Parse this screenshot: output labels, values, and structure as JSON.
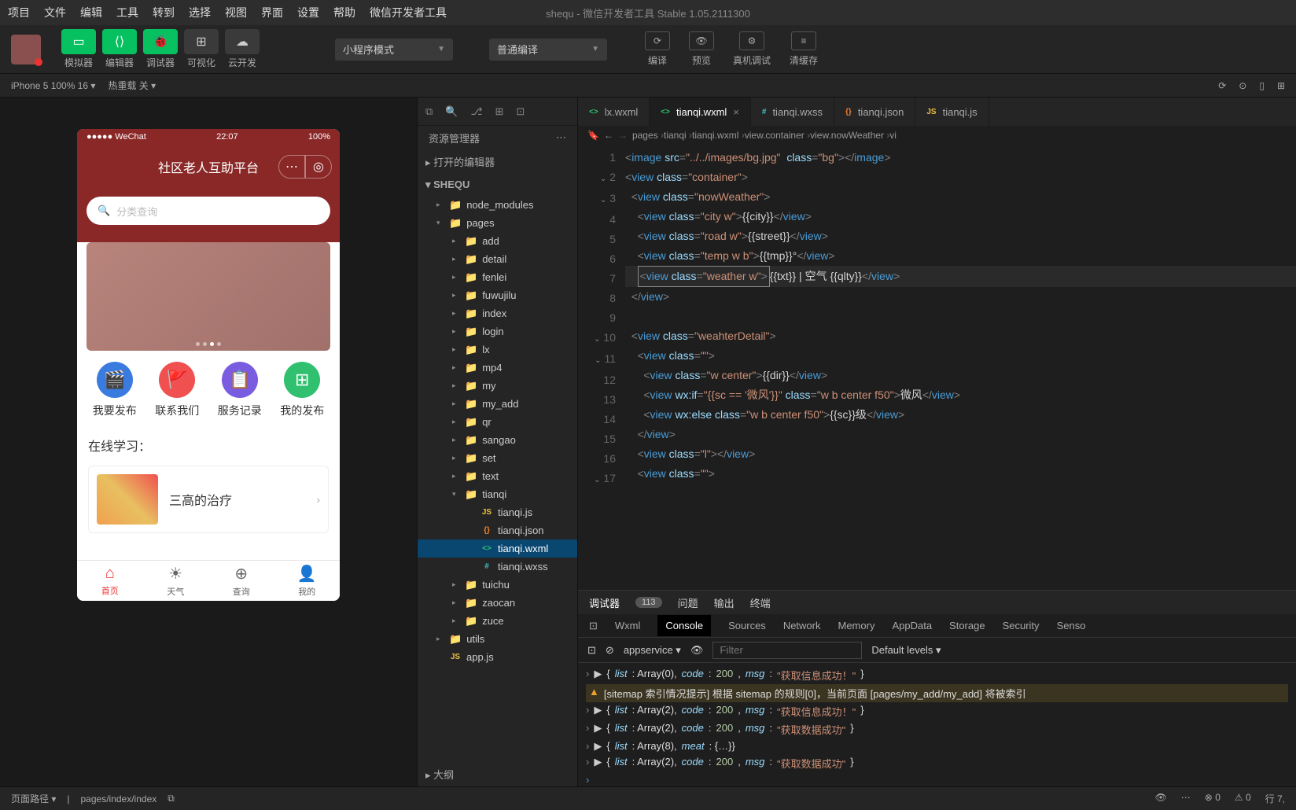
{
  "menubar": [
    "项目",
    "文件",
    "编辑",
    "工具",
    "转到",
    "选择",
    "视图",
    "界面",
    "设置",
    "帮助",
    "微信开发者工具"
  ],
  "window_title": "shequ - 微信开发者工具 Stable 1.05.2111300",
  "toolbar": {
    "items": [
      {
        "label": "模拟器"
      },
      {
        "label": "编辑器"
      },
      {
        "label": "调试器"
      },
      {
        "label": "可视化"
      },
      {
        "label": "云开发"
      }
    ],
    "mode_dropdown": "小程序模式",
    "compile_dropdown": "普通编译",
    "actions": [
      {
        "label": "编译"
      },
      {
        "label": "预览"
      },
      {
        "label": "真机调试"
      },
      {
        "label": "清缓存"
      }
    ]
  },
  "secondbar": {
    "device": "iPhone 5 100% 16",
    "reload": "热重载 关"
  },
  "phone": {
    "carrier": "●●●●● WeChat",
    "time": "22:07",
    "battery": "100%",
    "title": "社区老人互助平台",
    "search_placeholder": "分类查询",
    "icons": [
      {
        "label": "我要发布",
        "color": "#3a7be0"
      },
      {
        "label": "联系我们",
        "color": "#f05050"
      },
      {
        "label": "服务记录",
        "color": "#7a5ce0"
      },
      {
        "label": "我的发布",
        "color": "#30c070"
      }
    ],
    "section": "在线学习：",
    "card_title": "三高的治疗",
    "tabs": [
      {
        "label": "首页",
        "active": true
      },
      {
        "label": "天气",
        "active": false
      },
      {
        "label": "查询",
        "active": false
      },
      {
        "label": "我的",
        "active": false
      }
    ]
  },
  "explorer": {
    "title": "资源管理器",
    "open_editors": "打开的编辑器",
    "root": "SHEQU",
    "outline": "大纲",
    "tree": [
      {
        "name": "node_modules",
        "type": "folder",
        "indent": 1,
        "expanded": false,
        "color": "#30c070"
      },
      {
        "name": "pages",
        "type": "folder",
        "indent": 1,
        "expanded": true,
        "color": "#c09050"
      },
      {
        "name": "add",
        "type": "folder",
        "indent": 2
      },
      {
        "name": "detail",
        "type": "folder",
        "indent": 2
      },
      {
        "name": "fenlei",
        "type": "folder",
        "indent": 2
      },
      {
        "name": "fuwujilu",
        "type": "folder",
        "indent": 2
      },
      {
        "name": "index",
        "type": "folder",
        "indent": 2
      },
      {
        "name": "login",
        "type": "folder",
        "indent": 2
      },
      {
        "name": "lx",
        "type": "folder",
        "indent": 2
      },
      {
        "name": "mp4",
        "type": "folder",
        "indent": 2
      },
      {
        "name": "my",
        "type": "folder",
        "indent": 2
      },
      {
        "name": "my_add",
        "type": "folder",
        "indent": 2
      },
      {
        "name": "qr",
        "type": "folder",
        "indent": 2
      },
      {
        "name": "sangao",
        "type": "folder",
        "indent": 2
      },
      {
        "name": "set",
        "type": "folder",
        "indent": 2
      },
      {
        "name": "text",
        "type": "folder",
        "indent": 2
      },
      {
        "name": "tianqi",
        "type": "folder",
        "indent": 2,
        "expanded": true
      },
      {
        "name": "tianqi.js",
        "type": "file",
        "indent": 3,
        "ficon": "JS",
        "fcolor": "#f0c040"
      },
      {
        "name": "tianqi.json",
        "type": "file",
        "indent": 3,
        "ficon": "{}",
        "fcolor": "#f08030"
      },
      {
        "name": "tianqi.wxml",
        "type": "file",
        "indent": 3,
        "ficon": "<>",
        "fcolor": "#30c070",
        "selected": true
      },
      {
        "name": "tianqi.wxss",
        "type": "file",
        "indent": 3,
        "ficon": "#",
        "fcolor": "#40c0d0"
      },
      {
        "name": "tuichu",
        "type": "folder",
        "indent": 2
      },
      {
        "name": "zaocan",
        "type": "folder",
        "indent": 2
      },
      {
        "name": "zuce",
        "type": "folder",
        "indent": 2
      },
      {
        "name": "utils",
        "type": "folder",
        "indent": 1,
        "color": "#30c070"
      },
      {
        "name": "app.js",
        "type": "file",
        "indent": 1,
        "ficon": "JS",
        "fcolor": "#f0c040"
      }
    ]
  },
  "editor_tabs": [
    {
      "name": "lx.wxml",
      "icon": "<>",
      "color": "#30c070"
    },
    {
      "name": "tianqi.wxml",
      "icon": "<>",
      "color": "#30c070",
      "active": true,
      "close": true
    },
    {
      "name": "tianqi.wxss",
      "icon": "#",
      "color": "#40c0d0"
    },
    {
      "name": "tianqi.json",
      "icon": "{}",
      "color": "#f08030"
    },
    {
      "name": "tianqi.js",
      "icon": "JS",
      "color": "#f0c040"
    }
  ],
  "breadcrumb": [
    "pages",
    "tianqi",
    "tianqi.wxml",
    "view.container",
    "view.nowWeather",
    "vi"
  ],
  "code_lines": [
    {
      "n": 1,
      "html": "<span class='tag'>&lt;</span><span class='tagname'>image</span> <span class='attr'>src</span><span class='tag'>=</span><span class='str'>\"../../images/bg.jpg\"</span>  <span class='attr'>class</span><span class='tag'>=</span><span class='str'>\"bg\"</span><span class='tag'>&gt;&lt;/</span><span class='tagname'>image</span><span class='tag'>&gt;</span>"
    },
    {
      "n": 2,
      "fold": true,
      "html": "<span class='tag'>&lt;</span><span class='tagname'>view</span> <span class='attr'>class</span><span class='tag'>=</span><span class='str'>\"container\"</span><span class='tag'>&gt;</span>"
    },
    {
      "n": 3,
      "fold": true,
      "html": "  <span class='tag'>&lt;</span><span class='tagname'>view</span> <span class='attr'>class</span><span class='tag'>=</span><span class='str'>\"nowWeather\"</span><span class='tag'>&gt;</span>"
    },
    {
      "n": 4,
      "html": "    <span class='tag'>&lt;</span><span class='tagname'>view</span> <span class='attr'>class</span><span class='tag'>=</span><span class='str'>\"city w\"</span><span class='tag'>&gt;</span><span class='txt'>{{city}}</span><span class='tag'>&lt;/</span><span class='tagname'>view</span><span class='tag'>&gt;</span>"
    },
    {
      "n": 5,
      "html": "    <span class='tag'>&lt;</span><span class='tagname'>view</span> <span class='attr'>class</span><span class='tag'>=</span><span class='str'>\"road w\"</span><span class='tag'>&gt;</span><span class='txt'>{{street}}</span><span class='tag'>&lt;/</span><span class='tagname'>view</span><span class='tag'>&gt;</span>"
    },
    {
      "n": 6,
      "html": "    <span class='tag'>&lt;</span><span class='tagname'>view</span> <span class='attr'>class</span><span class='tag'>=</span><span class='str'>\"temp w b\"</span><span class='tag'>&gt;</span><span class='txt'>{{tmp}}°</span><span class='tag'>&lt;/</span><span class='tagname'>view</span><span class='tag'>&gt;</span>"
    },
    {
      "n": 7,
      "hl": true,
      "html": "    <span class='cursor-box'><span class='tag'>&lt;</span><span class='tagname'>view</span> <span class='attr'>class</span><span class='tag'>=</span><span class='str'>\"weather w\"</span><span class='tag'>&gt;</span></span><span class='txt'>{{txt}} | 空气 {{qlty}}</span><span class='tag'>&lt;/</span><span class='tagname'>view</span><span class='tag'>&gt;</span>"
    },
    {
      "n": 8,
      "html": "  <span class='tag'>&lt;/</span><span class='tagname'>view</span><span class='tag'>&gt;</span>"
    },
    {
      "n": 9,
      "html": ""
    },
    {
      "n": 10,
      "fold": true,
      "html": "  <span class='tag'>&lt;</span><span class='tagname'>view</span> <span class='attr'>class</span><span class='tag'>=</span><span class='str'>\"weahterDetail\"</span><span class='tag'>&gt;</span>"
    },
    {
      "n": 11,
      "fold": true,
      "html": "    <span class='tag'>&lt;</span><span class='tagname'>view</span> <span class='attr'>class</span><span class='tag'>=</span><span class='str'>\"\"</span><span class='tag'>&gt;</span>"
    },
    {
      "n": 12,
      "html": "      <span class='tag'>&lt;</span><span class='tagname'>view</span> <span class='attr'>class</span><span class='tag'>=</span><span class='str'>\"w center\"</span><span class='tag'>&gt;</span><span class='txt'>{{dir}}</span><span class='tag'>&lt;/</span><span class='tagname'>view</span><span class='tag'>&gt;</span>"
    },
    {
      "n": 13,
      "html": "      <span class='tag'>&lt;</span><span class='tagname'>view</span> <span class='attr'>wx:if</span><span class='tag'>=</span><span class='str'>\"{{sc == '微风'}}\"</span> <span class='attr'>class</span><span class='tag'>=</span><span class='str'>\"w b center f50\"</span><span class='tag'>&gt;</span><span class='txt'>微风</span><span class='tag'>&lt;/</span><span class='tagname'>view</span><span class='tag'>&gt;</span>"
    },
    {
      "n": 14,
      "html": "      <span class='tag'>&lt;</span><span class='tagname'>view</span> <span class='attr'>wx:else</span> <span class='attr'>class</span><span class='tag'>=</span><span class='str'>\"w b center f50\"</span><span class='tag'>&gt;</span><span class='txt'>{{sc}}级</span><span class='tag'>&lt;/</span><span class='tagname'>view</span><span class='tag'>&gt;</span>"
    },
    {
      "n": 15,
      "html": "    <span class='tag'>&lt;/</span><span class='tagname'>view</span><span class='tag'>&gt;</span>"
    },
    {
      "n": 16,
      "html": "    <span class='tag'>&lt;</span><span class='tagname'>view</span> <span class='attr'>class</span><span class='tag'>=</span><span class='str'>\"l\"</span><span class='tag'>&gt;&lt;/</span><span class='tagname'>view</span><span class='tag'>&gt;</span>"
    },
    {
      "n": 17,
      "fold": true,
      "html": "    <span class='tag'>&lt;</span><span class='tagname'>view</span> <span class='attr'>class</span><span class='tag'>=</span><span class='str'>\"\"</span><span class='tag'>&gt;</span>"
    }
  ],
  "console": {
    "tabs": [
      "调试器",
      "问题",
      "输出",
      "终端"
    ],
    "badge": "113",
    "subtabs": [
      "Wxml",
      "Console",
      "Sources",
      "Network",
      "Memory",
      "AppData",
      "Storage",
      "Security",
      "Senso"
    ],
    "active_subtab": "Console",
    "context": "appservice",
    "filter_placeholder": "Filter",
    "levels": "Default levels",
    "lines": [
      {
        "type": "log",
        "html": "▶ <span class='c-plain'>{</span><span class='c-key'>list</span><span class='c-plain'>: Array(0), </span><span class='c-key'>code</span><span class='c-plain'>: </span><span class='c-num'>200</span><span class='c-plain'>, </span><span class='c-key'>msg</span><span class='c-plain'>: </span><span class='c-str'>\"获取信息成功！\"</span><span class='c-plain'>}</span>"
      },
      {
        "type": "warn",
        "html": "<span class='c-plain'>[sitemap 索引情况提示] 根据 sitemap 的规则[0]，当前页面 [pages/my_add/my_add] 将被索引</span>"
      },
      {
        "type": "log",
        "html": "▶ <span class='c-plain'>{</span><span class='c-key'>list</span><span class='c-plain'>: Array(2), </span><span class='c-key'>code</span><span class='c-plain'>: </span><span class='c-num'>200</span><span class='c-plain'>, </span><span class='c-key'>msg</span><span class='c-plain'>: </span><span class='c-str'>\"获取信息成功！\"</span><span class='c-plain'>}</span>"
      },
      {
        "type": "log",
        "html": "▶ <span class='c-plain'>{</span><span class='c-key'>list</span><span class='c-plain'>: Array(2), </span><span class='c-key'>code</span><span class='c-plain'>: </span><span class='c-num'>200</span><span class='c-plain'>, </span><span class='c-key'>msg</span><span class='c-plain'>: </span><span class='c-str'>\"获取数据成功\"</span><span class='c-plain'>}</span>"
      },
      {
        "type": "log",
        "html": "▶ <span class='c-plain'>{</span><span class='c-key'>list</span><span class='c-plain'>: Array(8), </span><span class='c-key'>meat</span><span class='c-plain'>: {…}}</span>"
      },
      {
        "type": "log",
        "html": "▶ <span class='c-plain'>{</span><span class='c-key'>list</span><span class='c-plain'>: Array(2), </span><span class='c-key'>code</span><span class='c-plain'>: </span><span class='c-num'>200</span><span class='c-plain'>, </span><span class='c-key'>msg</span><span class='c-plain'>: </span><span class='c-str'>\"获取数据成功\"</span><span class='c-plain'>}</span>"
      }
    ]
  },
  "statusbar": {
    "page_path_label": "页面路径",
    "page_path": "pages/index/index",
    "errors": "0",
    "warnings": "0",
    "cursor": "行 7,"
  }
}
